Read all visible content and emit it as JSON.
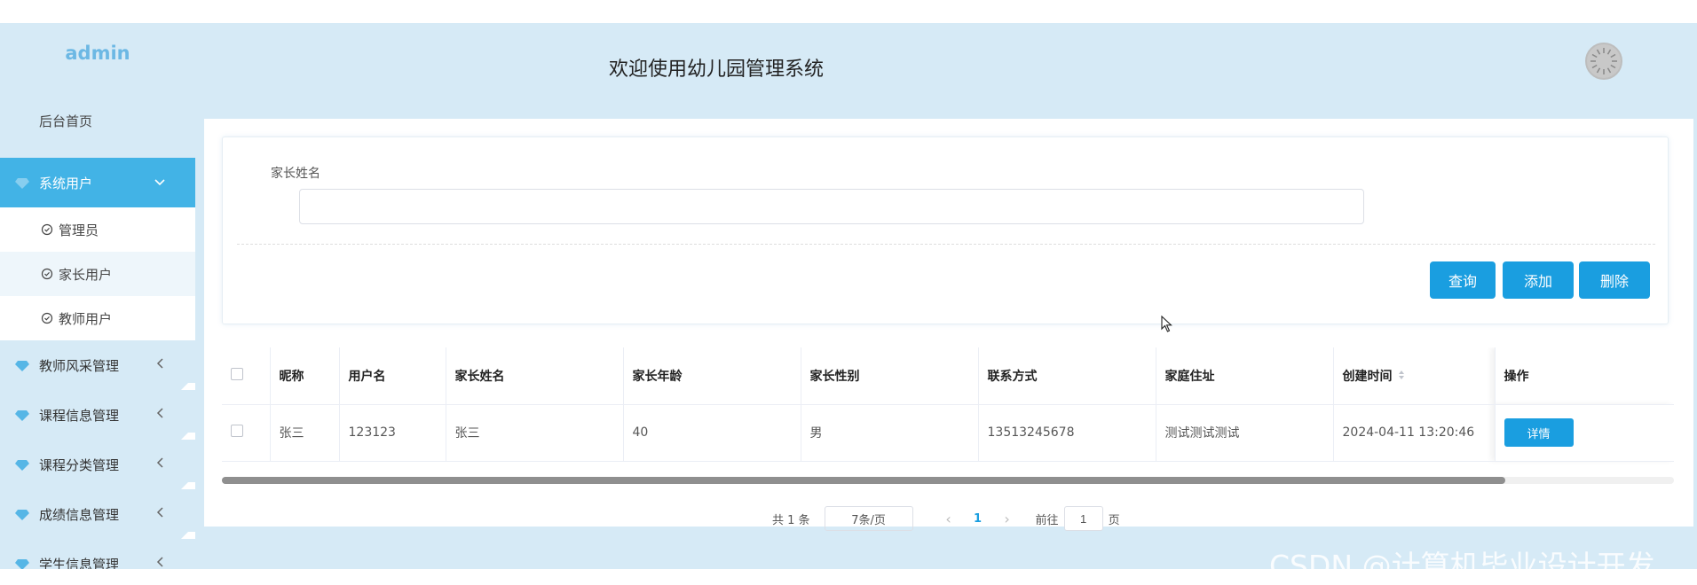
{
  "sidebar": {
    "brand": "admin",
    "home": "后台首页",
    "active_group": "系统用户",
    "sub_items": [
      "管理员",
      "家长用户",
      "教师用户"
    ],
    "groups": [
      "教师风采管理",
      "课程信息管理",
      "课程分类管理",
      "成绩信息管理",
      "学生信息管理"
    ]
  },
  "header": {
    "title": "欢迎使用幼儿园管理系统"
  },
  "search": {
    "label": "家长姓名",
    "value": "",
    "query_label": "查询",
    "add_label": "添加",
    "delete_label": "删除"
  },
  "table": {
    "headers": [
      "昵称",
      "用户名",
      "家长姓名",
      "家长年龄",
      "家长性别",
      "联系方式",
      "家庭住址",
      "创建时间",
      "操作"
    ],
    "rows": [
      [
        "张三",
        "123123",
        "张三",
        "40",
        "男",
        "13513245678",
        "测试测试测试",
        "2024-04-11 13:20:46"
      ]
    ],
    "detail_label": "详情"
  },
  "pagination": {
    "total": "共 1 条",
    "page_size": "7条/页",
    "current_page": "1",
    "goto_prefix": "前往",
    "goto_value": "1",
    "goto_suffix": "页"
  },
  "watermark": "CSDN @计算机毕业设计开发",
  "colors": {
    "primary": "#1a9ee0",
    "sidebar_bg": "#d6eaf6",
    "active_menu": "#42b3e6",
    "brand": "#6cb8e4"
  }
}
